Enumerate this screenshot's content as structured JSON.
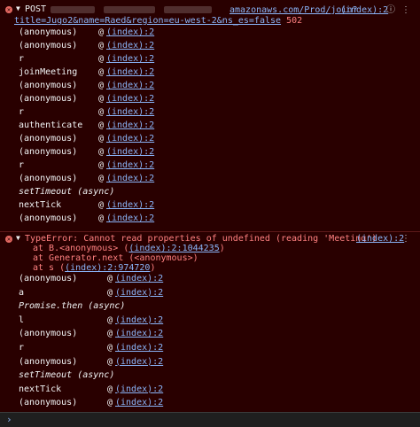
{
  "block1": {
    "method": "POST",
    "url_domain_suffix": "amazonaws.com/Prod/join?",
    "url_query": "title=Jugo2&name=Raed&region=eu-west-2&ns_es=false",
    "status_code": "502",
    "source_link": "(index):2",
    "frames": [
      {
        "fn": "(anonymous)",
        "at": "@",
        "loc": "(index):2"
      },
      {
        "fn": "(anonymous)",
        "at": "@",
        "loc": "(index):2"
      },
      {
        "fn": "r",
        "at": "@",
        "loc": "(index):2"
      },
      {
        "fn": "joinMeeting",
        "at": "@",
        "loc": "(index):2"
      },
      {
        "fn": "(anonymous)",
        "at": "@",
        "loc": "(index):2"
      },
      {
        "fn": "(anonymous)",
        "at": "@",
        "loc": "(index):2"
      },
      {
        "fn": "r",
        "at": "@",
        "loc": "(index):2"
      },
      {
        "fn": "authenticate",
        "at": "@",
        "loc": "(index):2"
      },
      {
        "fn": "(anonymous)",
        "at": "@",
        "loc": "(index):2"
      },
      {
        "fn": "(anonymous)",
        "at": "@",
        "loc": "(index):2"
      },
      {
        "fn": "r",
        "at": "@",
        "loc": "(index):2"
      },
      {
        "fn": "(anonymous)",
        "at": "@",
        "loc": "(index):2"
      },
      {
        "fn": "setTimeout (async)",
        "at": "",
        "loc": ""
      },
      {
        "fn": "nextTick",
        "at": "@",
        "loc": "(index):2"
      },
      {
        "fn": "(anonymous)",
        "at": "@",
        "loc": "(index):2"
      }
    ]
  },
  "block2": {
    "message": "TypeError: Cannot read properties of undefined (reading 'Meeting')",
    "source_link": "(index):2",
    "stack": [
      {
        "prefix": "at B.<anonymous> (",
        "link": "(index):2:1044235",
        "suffix": ")"
      },
      {
        "prefix": "at Generator.next (<anonymous>)",
        "link": "",
        "suffix": ""
      },
      {
        "prefix": "at s (",
        "link": "(index):2:974720",
        "suffix": ")"
      }
    ],
    "frames": [
      {
        "fn": "(anonymous)",
        "at": "@",
        "loc": "(index):2"
      },
      {
        "fn": "a",
        "at": "@",
        "loc": "(index):2"
      },
      {
        "fn": "Promise.then (async)",
        "at": "",
        "loc": ""
      },
      {
        "fn": "l",
        "at": "@",
        "loc": "(index):2"
      },
      {
        "fn": "(anonymous)",
        "at": "@",
        "loc": "(index):2"
      },
      {
        "fn": "r",
        "at": "@",
        "loc": "(index):2"
      },
      {
        "fn": "(anonymous)",
        "at": "@",
        "loc": "(index):2"
      },
      {
        "fn": "setTimeout (async)",
        "at": "",
        "loc": ""
      },
      {
        "fn": "nextTick",
        "at": "@",
        "loc": "(index):2"
      },
      {
        "fn": "(anonymous)",
        "at": "@",
        "loc": "(index):2"
      }
    ]
  },
  "prompt": {
    "chevron": "›"
  },
  "colors": {
    "background": "#290000",
    "link": "#8ab4f8",
    "error": "#ff8080",
    "error_icon": "#e46962"
  }
}
